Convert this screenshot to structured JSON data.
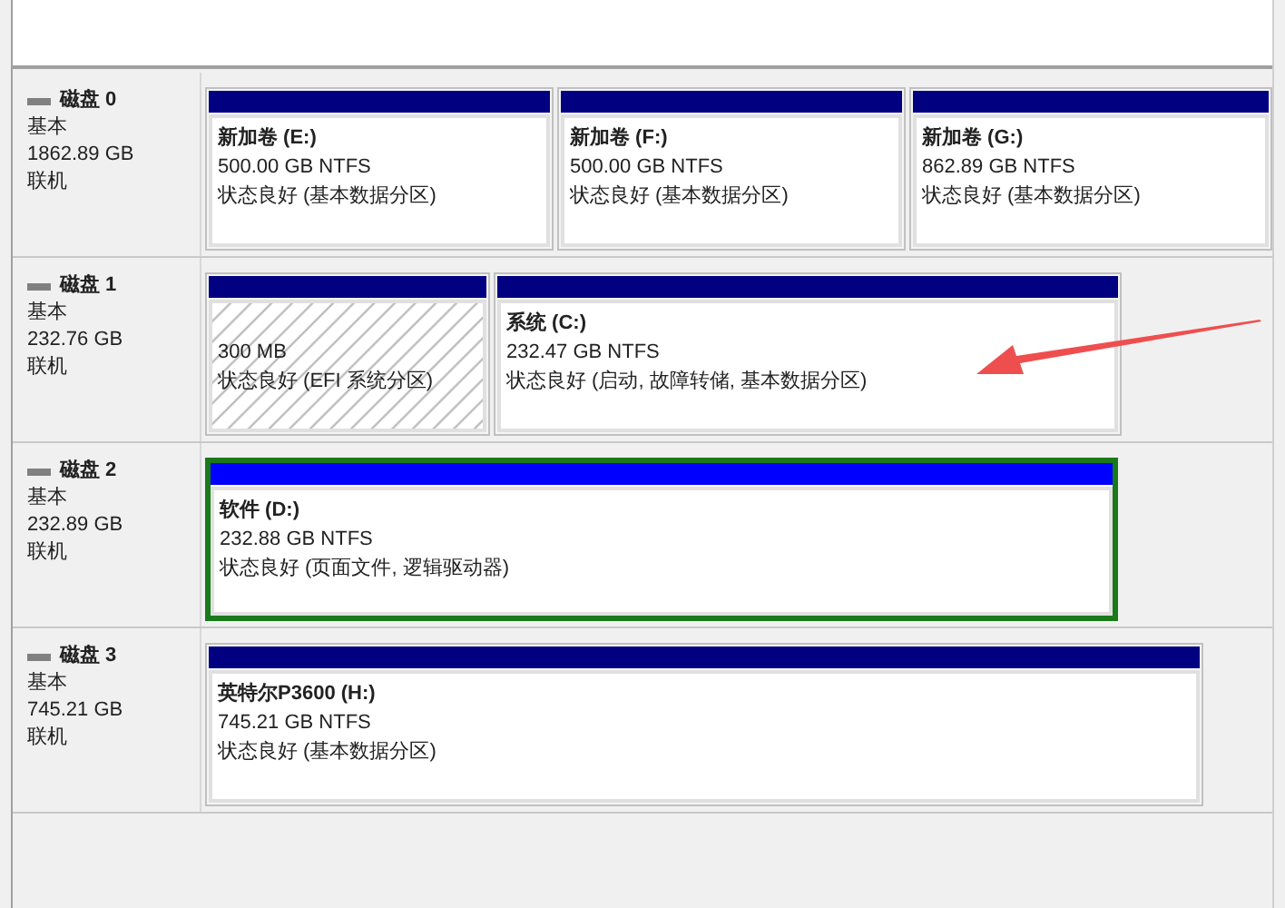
{
  "disks": [
    {
      "name": "磁盘 0",
      "type": "基本",
      "size": "1862.89 GB",
      "status": "联机",
      "partitions": [
        {
          "kind": "primary",
          "label": "新加卷 (E:)",
          "size": "500.00 GB NTFS",
          "status": "状态良好 (基本数据分区)",
          "selected": false
        },
        {
          "kind": "primary",
          "label": "新加卷 (F:)",
          "size": "500.00 GB NTFS",
          "status": "状态良好 (基本数据分区)",
          "selected": false
        },
        {
          "kind": "primary",
          "label": "新加卷 (G:)",
          "size": "862.89 GB NTFS",
          "status": "状态良好 (基本数据分区)",
          "selected": false
        }
      ]
    },
    {
      "name": "磁盘 1",
      "type": "基本",
      "size": "232.76 GB",
      "status": "联机",
      "partitions": [
        {
          "kind": "efi",
          "size": "300 MB",
          "status": "状态良好 (EFI 系统分区)",
          "selected": false
        },
        {
          "kind": "primary",
          "label": "系统 (C:)",
          "size": "232.47 GB NTFS",
          "status": "状态良好 (启动, 故障转储, 基本数据分区)",
          "selected": false
        }
      ]
    },
    {
      "name": "磁盘 2",
      "type": "基本",
      "size": "232.89 GB",
      "status": "联机",
      "partitions": [
        {
          "kind": "logical",
          "label": "软件 (D:)",
          "size": "232.88 GB NTFS",
          "status": "状态良好 (页面文件, 逻辑驱动器)",
          "selected": true
        }
      ]
    },
    {
      "name": "磁盘 3",
      "type": "基本",
      "size": "745.21 GB",
      "status": "联机",
      "partitions": [
        {
          "kind": "primary",
          "label": "英特尔P3600 (H:)",
          "size": "745.21 GB NTFS",
          "status": "状态良好 (基本数据分区)",
          "selected": false
        }
      ]
    }
  ]
}
